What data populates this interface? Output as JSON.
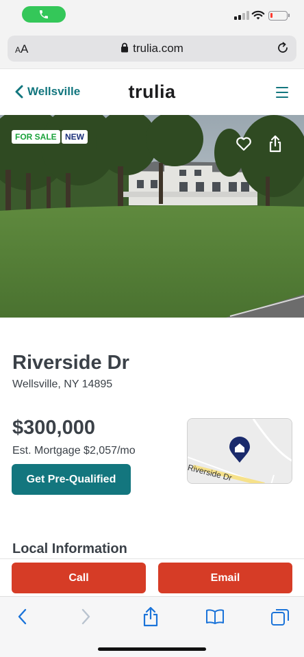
{
  "browser": {
    "domain": "trulia.com",
    "text_size_label": "AA"
  },
  "header": {
    "back_label": "Wellsville",
    "logo_text": "trulia"
  },
  "hero": {
    "badges": [
      "FOR SALE",
      "NEW"
    ]
  },
  "listing": {
    "street": "Riverside Dr",
    "city_state_zip": "Wellsville, NY 14895",
    "price": "$300,000",
    "est_mortgage": "Est. Mortgage $2,057/mo",
    "prequalify_label": "Get Pre-Qualified",
    "map_street_label": "Riverside Dr"
  },
  "sections": {
    "local_info_title": "Local Information"
  },
  "contact": {
    "call_label": "Call",
    "email_label": "Email"
  },
  "status": {
    "battery_level": 0.15
  },
  "colors": {
    "brand_teal": "#13767e",
    "contact_red": "#d63c26",
    "badge_green": "#1aa23a",
    "badge_navy": "#1a2f7a",
    "call_green": "#34c759"
  },
  "icons": [
    "phone-icon",
    "signal-icon",
    "wifi-icon",
    "battery-icon",
    "lock-icon",
    "reload-icon",
    "chevron-left-icon",
    "menu-icon",
    "heart-icon",
    "share-icon",
    "map-pin-icon",
    "back-arrow-icon",
    "forward-arrow-icon",
    "bookmarks-icon",
    "tabs-icon"
  ]
}
